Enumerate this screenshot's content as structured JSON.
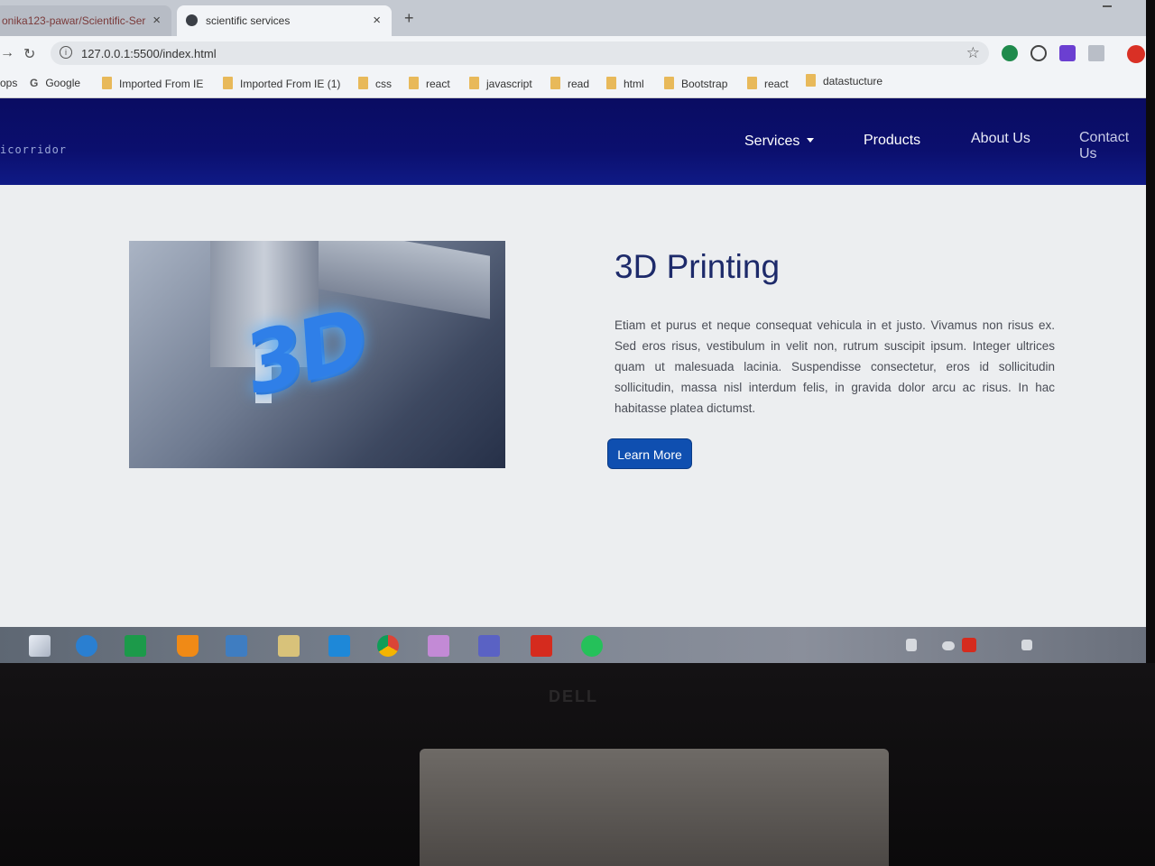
{
  "browser": {
    "tabs": [
      {
        "title": "onika123-pawar/Scientific-Ser"
      },
      {
        "title": "scientific services"
      }
    ],
    "url": "127.0.0.1:5500/index.html",
    "bookmarks": [
      "ops",
      "Google",
      "Imported From IE",
      "Imported From IE (1)",
      "css",
      "react",
      "javascript",
      "read",
      "html",
      "Bootstrap",
      "react",
      "datastucture"
    ]
  },
  "site": {
    "logo": "icorridor",
    "nav": {
      "services": "Services",
      "products": "Products",
      "about": "About Us",
      "contact": "Contact Us"
    },
    "section": {
      "heading": "3D Printing",
      "image_text": "3D",
      "paragraph": "Etiam et purus et neque consequat vehicula in et justo. Vivamus non risus ex. Sed eros risus, vestibulum in velit non, rutrum suscipit ipsum. Integer ultrices quam ut malesuada lacinia. Suspendisse consectetur, eros id sollicitudin sollicitudin, massa nisl interdum felis, in gravida dolor arcu ac risus. In hac habitasse platea dictumst.",
      "button": "Learn More"
    }
  },
  "monitor": {
    "brand": "DELL"
  },
  "colors": {
    "navbar": "#0a0c62",
    "button": "#0f4fb0",
    "heading": "#1d2a6a"
  }
}
